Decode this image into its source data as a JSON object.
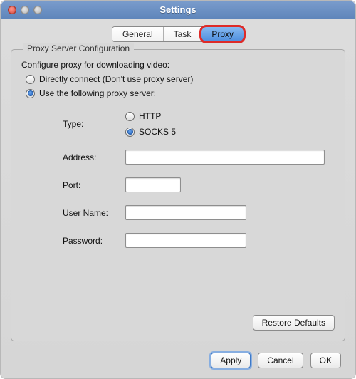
{
  "window": {
    "title": "Settings"
  },
  "tabs": {
    "general": {
      "label": "General"
    },
    "task": {
      "label": "Task"
    },
    "proxy": {
      "label": "Proxy"
    }
  },
  "group": {
    "legend": "Proxy Server Configuration",
    "subtitle": "Configure proxy for downloading video:",
    "radios": {
      "direct": {
        "label": "Directly connect (Don't use proxy server)"
      },
      "use_proxy": {
        "label": "Use the following proxy server:"
      }
    }
  },
  "fields": {
    "type_label": "Type:",
    "type_opts": {
      "http": {
        "label": "HTTP"
      },
      "socks5": {
        "label": "SOCKS 5"
      }
    },
    "address_label": "Address:",
    "address_value": "",
    "port_label": "Port:",
    "port_value": "",
    "username_label": "User Name:",
    "username_value": "",
    "password_label": "Password:",
    "password_value": ""
  },
  "buttons": {
    "restore": "Restore Defaults",
    "apply": "Apply",
    "cancel": "Cancel",
    "ok": "OK"
  }
}
